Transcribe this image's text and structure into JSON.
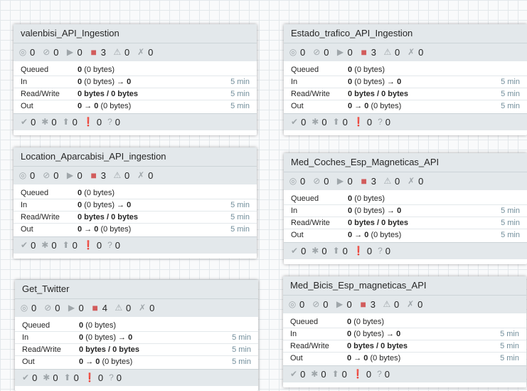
{
  "groups": [
    {
      "name": "valenbisi_API_Ingestion",
      "status": {
        "transmitting": "0",
        "not_transmitting": "0",
        "running": "0",
        "stopped": "3",
        "invalid": "0",
        "disabled": "0"
      },
      "stats": {
        "queued_label": "Queued",
        "queued_count": "0",
        "queued_bytes": "(0 bytes)",
        "in_label": "In",
        "in_count": "0",
        "in_bytes": "(0 bytes)",
        "in_arrow": "→",
        "in_out": "0",
        "in_time": "5 min",
        "rw_label": "Read/Write",
        "rw_value": "0 bytes / 0 bytes",
        "rw_time": "5 min",
        "out_label": "Out",
        "out_from": "0",
        "out_arrow": "→",
        "out_to": "0",
        "out_bytes": "(0 bytes)",
        "out_time": "5 min"
      },
      "versions": {
        "up_to_date": "0",
        "locally_modified": "0",
        "stale": "0",
        "modified_stale": "0",
        "sync_failure": "0"
      }
    },
    {
      "name": "Estado_trafico_API_Ingestion",
      "status": {
        "transmitting": "0",
        "not_transmitting": "0",
        "running": "0",
        "stopped": "3",
        "invalid": "0",
        "disabled": "0"
      },
      "stats": {
        "queued_label": "Queued",
        "queued_count": "0",
        "queued_bytes": "(0 bytes)",
        "in_label": "In",
        "in_count": "0",
        "in_bytes": "(0 bytes)",
        "in_arrow": "→",
        "in_out": "0",
        "in_time": "5 min",
        "rw_label": "Read/Write",
        "rw_value": "0 bytes / 0 bytes",
        "rw_time": "5 min",
        "out_label": "Out",
        "out_from": "0",
        "out_arrow": "→",
        "out_to": "0",
        "out_bytes": "(0 bytes)",
        "out_time": "5 min"
      },
      "versions": {
        "up_to_date": "0",
        "locally_modified": "0",
        "stale": "0",
        "modified_stale": "0",
        "sync_failure": "0"
      }
    },
    {
      "name": "Location_Aparcabisi_API_ingestion",
      "status": {
        "transmitting": "0",
        "not_transmitting": "0",
        "running": "0",
        "stopped": "3",
        "invalid": "0",
        "disabled": "0"
      },
      "stats": {
        "queued_label": "Queued",
        "queued_count": "0",
        "queued_bytes": "(0 bytes)",
        "in_label": "In",
        "in_count": "0",
        "in_bytes": "(0 bytes)",
        "in_arrow": "→",
        "in_out": "0",
        "in_time": "5 min",
        "rw_label": "Read/Write",
        "rw_value": "0 bytes / 0 bytes",
        "rw_time": "5 min",
        "out_label": "Out",
        "out_from": "0",
        "out_arrow": "→",
        "out_to": "0",
        "out_bytes": "(0 bytes)",
        "out_time": "5 min"
      },
      "versions": {
        "up_to_date": "0",
        "locally_modified": "0",
        "stale": "0",
        "modified_stale": "0",
        "sync_failure": "0"
      }
    },
    {
      "name": "Med_Coches_Esp_Magneticas_API",
      "status": {
        "transmitting": "0",
        "not_transmitting": "0",
        "running": "0",
        "stopped": "3",
        "invalid": "0",
        "disabled": "0"
      },
      "stats": {
        "queued_label": "Queued",
        "queued_count": "0",
        "queued_bytes": "(0 bytes)",
        "in_label": "In",
        "in_count": "0",
        "in_bytes": "(0 bytes)",
        "in_arrow": "→",
        "in_out": "0",
        "in_time": "5 min",
        "rw_label": "Read/Write",
        "rw_value": "0 bytes / 0 bytes",
        "rw_time": "5 min",
        "out_label": "Out",
        "out_from": "0",
        "out_arrow": "→",
        "out_to": "0",
        "out_bytes": "(0 bytes)",
        "out_time": "5 min"
      },
      "versions": {
        "up_to_date": "0",
        "locally_modified": "0",
        "stale": "0",
        "modified_stale": "0",
        "sync_failure": "0"
      }
    },
    {
      "name": "Get_Twitter",
      "status": {
        "transmitting": "0",
        "not_transmitting": "0",
        "running": "0",
        "stopped": "4",
        "invalid": "0",
        "disabled": "0"
      },
      "stats": {
        "queued_label": "Queued",
        "queued_count": "0",
        "queued_bytes": "(0 bytes)",
        "in_label": "In",
        "in_count": "0",
        "in_bytes": "(0 bytes)",
        "in_arrow": "→",
        "in_out": "0",
        "in_time": "5 min",
        "rw_label": "Read/Write",
        "rw_value": "0 bytes / 0 bytes",
        "rw_time": "5 min",
        "out_label": "Out",
        "out_from": "0",
        "out_arrow": "→",
        "out_to": "0",
        "out_bytes": "(0 bytes)",
        "out_time": "5 min"
      },
      "versions": {
        "up_to_date": "0",
        "locally_modified": "0",
        "stale": "0",
        "modified_stale": "0",
        "sync_failure": "0"
      }
    },
    {
      "name": "Med_Bicis_Esp_magneticas_API",
      "status": {
        "transmitting": "0",
        "not_transmitting": "0",
        "running": "0",
        "stopped": "3",
        "invalid": "0",
        "disabled": "0"
      },
      "stats": {
        "queued_label": "Queued",
        "queued_count": "0",
        "queued_bytes": "(0 bytes)",
        "in_label": "In",
        "in_count": "0",
        "in_bytes": "(0 bytes)",
        "in_arrow": "→",
        "in_out": "0",
        "in_time": "5 min",
        "rw_label": "Read/Write",
        "rw_value": "0 bytes / 0 bytes",
        "rw_time": "5 min",
        "out_label": "Out",
        "out_from": "0",
        "out_arrow": "→",
        "out_to": "0",
        "out_bytes": "(0 bytes)",
        "out_time": "5 min"
      },
      "versions": {
        "up_to_date": "0",
        "locally_modified": "0",
        "stale": "0",
        "modified_stale": "0",
        "sync_failure": "0"
      }
    }
  ],
  "icons": {
    "transmitting": "transmitting-icon",
    "not_transmitting": "not-transmitting-icon",
    "running": "running-icon",
    "stopped": "stopped-icon",
    "invalid": "invalid-icon",
    "disabled": "disabled-icon",
    "up_to_date": "up-to-date-icon",
    "locally_modified": "locally-modified-icon",
    "stale": "stale-icon",
    "modified_stale": "locally-modified-stale-icon",
    "sync_failure": "sync-failure-icon"
  },
  "colors": {
    "stopped": "#d25c5c",
    "header": "#e3e8eb",
    "muted": "#728e9b"
  }
}
